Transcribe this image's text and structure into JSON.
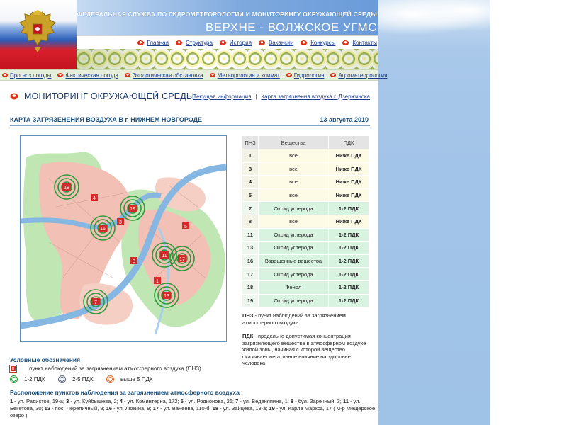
{
  "header": {
    "agency": "ФЕДЕРАЛЬНАЯ СЛУЖБА ПО ГИДРОМЕТЕОРОЛОГИИ И МОНИТОРИНГУ ОКРУЖАЮЩЕЙ СРЕДЫ",
    "title": "ВЕРХНЕ - ВОЛЖСКОЕ УГМС"
  },
  "topnav": [
    "Главная",
    "Структура",
    "История",
    "Вакансии",
    "Конкурсы",
    "Контакты"
  ],
  "subnav": [
    "Прогноз погоды",
    "Фактическая погода",
    "Экологическая обстановка",
    "Метеорология и климат",
    "Гидрология",
    "Агрометеорология"
  ],
  "section": {
    "title": "МОНИТОРИНГ ОКРУЖАЮЩЕЙ СРЕДЫ",
    "crumb1": "Текущая информация",
    "separator": "|",
    "crumb2": "Карта загрязнения воздуха г. Дзержинска"
  },
  "map": {
    "title": "КАРТА ЗАГРЯЗЕНЕНИЯ ВОЗДУХА В г. НИЖНЕМ НОВГОРОДЕ",
    "date": "13 августа 2010",
    "stations": [
      {
        "id": "18",
        "level": "1-2 ПДК"
      },
      {
        "id": "4",
        "level": "Ниже ПДК"
      },
      {
        "id": "19",
        "level": "1-2 ПДК"
      },
      {
        "id": "3",
        "level": "Ниже ПДК"
      },
      {
        "id": "16",
        "level": "1-2 ПДК"
      },
      {
        "id": "5",
        "level": "Ниже ПДК"
      },
      {
        "id": "11",
        "level": "1-2 ПДК"
      },
      {
        "id": "17",
        "level": "1-2 ПДК"
      },
      {
        "id": "8",
        "level": "Ниже ПДК"
      },
      {
        "id": "1",
        "level": "Ниже ПДК"
      },
      {
        "id": "13",
        "level": "1-2 ПДК"
      },
      {
        "id": "7",
        "level": "1-2 ПДК"
      }
    ]
  },
  "table": {
    "headers": [
      "ПНЗ",
      "Вещества",
      "ПДК"
    ],
    "rows": [
      {
        "n": "1",
        "s": "все",
        "p": "Ниже ПДК",
        "cls": "low"
      },
      {
        "n": "3",
        "s": "все",
        "p": "Ниже ПДК",
        "cls": "low"
      },
      {
        "n": "4",
        "s": "все",
        "p": "Ниже ПДК",
        "cls": "low"
      },
      {
        "n": "5",
        "s": "все",
        "p": "Ниже ПДК",
        "cls": "low"
      },
      {
        "n": "7",
        "s": "Оксид углерода",
        "p": "1-2 ПДК",
        "cls": "mid"
      },
      {
        "n": "8",
        "s": "все",
        "p": "Ниже ПДК",
        "cls": "low"
      },
      {
        "n": "11",
        "s": "Оксид углерода",
        "p": "1-2 ПДК",
        "cls": "mid"
      },
      {
        "n": "13",
        "s": "Оксид углерода",
        "p": "1-2 ПДК",
        "cls": "mid"
      },
      {
        "n": "16",
        "s": "Взвешенные вещества",
        "p": "1-2 ПДК",
        "cls": "mid"
      },
      {
        "n": "17",
        "s": "Оксид углерода",
        "p": "1-2 ПДК",
        "cls": "mid"
      },
      {
        "n": "18",
        "s": "Фенол",
        "p": "1-2 ПДК",
        "cls": "mid"
      },
      {
        "n": "19",
        "s": "Оксид углерода",
        "p": "1-2 ПДК",
        "cls": "mid"
      }
    ]
  },
  "definitions": {
    "pnz_term": "ПНЗ",
    "pnz_text": " - пункт наблюдений за загрязнением атмосферного воздуха",
    "pdk_term": "ПДК",
    "pdk_text": " - предельно допустимая концентрация загрязняющего вещества в атмосферном воздухе жилой зоны, начиная с которой вещество оказывает негативное влияние на здоровье человека"
  },
  "legend": {
    "title": "Условные обозначения",
    "pnz_label": "пункт наблюдений за загрязнением атмосферного воздуха (ПНЗ)",
    "pnz_marker": "8",
    "level1": "1-2 ПДК",
    "level2": "2-5 ПДК",
    "level3": "выше 5 ПДК"
  },
  "locations": {
    "title": "Расположение пунктов наблюдения за загрязнением атмосферного воздуха",
    "items": [
      {
        "n": "1",
        "t": " - ул. Радистов, 19-а; "
      },
      {
        "n": "3",
        "t": " - ул. Куйбышева, 2; "
      },
      {
        "n": "4",
        "t": " - ул. Коминтерна, 172; "
      },
      {
        "n": "5",
        "t": " - ул. Родионова, 26; "
      },
      {
        "n": "7",
        "t": " - ул. Веденяпина, 1; "
      },
      {
        "n": "8",
        "t": " - бул. Заречный, 3; "
      },
      {
        "n": "11",
        "t": " - ул. Бекетова, 30; "
      },
      {
        "n": "13",
        "t": " - пос. Черепичный, 9; "
      },
      {
        "n": "16",
        "t": " - ул. Люкина, 9; "
      },
      {
        "n": "17",
        "t": " - ул. Ванеева, 110-б; "
      },
      {
        "n": "18",
        "t": " - ул. Зайцева, 18-а; "
      },
      {
        "n": "19",
        "t": " - ул. Карла Маркса, 17 ( м-р Мещерское озеро );"
      }
    ]
  },
  "colors": {
    "accent": "#1c4f7a",
    "link": "#1a3c8a",
    "flag_red": "#d71f2a",
    "flag_blue": "#2a5db8",
    "ring_green": "#2b9a3a",
    "station_red": "#d42a2a"
  }
}
